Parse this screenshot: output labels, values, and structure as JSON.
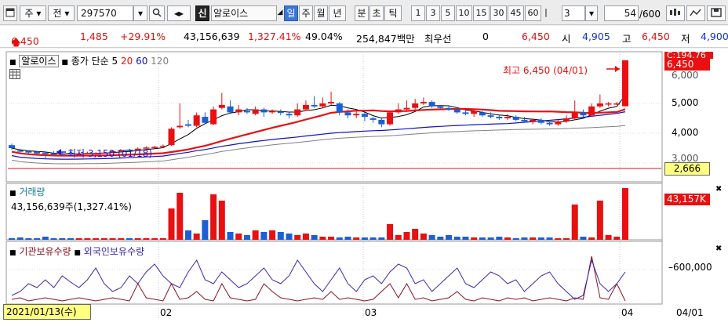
{
  "toolbar": {
    "market": "주",
    "prev_label": "전",
    "stock_code": "297570",
    "sin_label": "신",
    "stock_name": "알로이스",
    "periods": [
      "일",
      "주",
      "월",
      "년",
      "분",
      "초",
      "틱"
    ],
    "intervals": [
      "1",
      "3",
      "5",
      "10",
      "15",
      "30",
      "45",
      "60"
    ],
    "interval_value": "3",
    "count_value": "54",
    "count_total": "/600"
  },
  "price": {
    "current": "6,450",
    "change": "1,485",
    "change_rate": "+29.91%",
    "volume": "43,156,639",
    "volume_rate": "1,327.41%",
    "turnover": "49.04%",
    "amount": "254,847백만",
    "priority_label": "최우선",
    "priority_value": "0",
    "ask": "6,450",
    "open_label": "시",
    "open": "4,905",
    "high_label": "고",
    "high": "6,450",
    "low_label": "저",
    "low": "4,900"
  },
  "chart": {
    "title": "알로이스",
    "indicator": "종가 단순 5",
    "ma20": "20",
    "ma60": "60",
    "ma120": "120",
    "high_note": "최고 6,450 (04/01)",
    "low_note": "최저 3,150 (01/18)",
    "price_ticks": [
      "6,000",
      "5,000",
      "4,000",
      "3,000"
    ],
    "price_tag": "6,450",
    "price_tag_under": "C:194.76",
    "left_tag": "2,666",
    "volume_title": "거래량",
    "volume_value": "43,156,639주(1,327.41%)",
    "volume_tag": "43,157K",
    "bottom_title_a": "기관보유수량",
    "bottom_title_b": "외국인보유수량",
    "bottom_tick": "600,000",
    "date_cursor": "2021/01/13(수)",
    "x_ticks": [
      "02",
      "03",
      "04"
    ],
    "right_date": "04/01"
  },
  "colors": {
    "up": "#e81010",
    "down": "#1a5fd6",
    "ma5": "#000000",
    "ma20": "#e81010",
    "ma60": "#1010c0",
    "ma120": "#808080"
  }
}
